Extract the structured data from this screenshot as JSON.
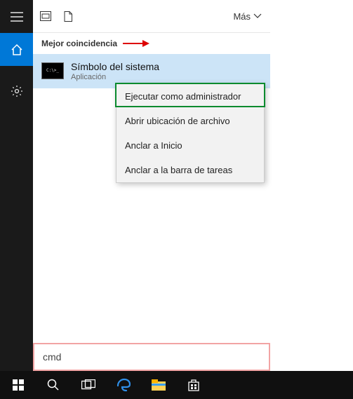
{
  "header": {
    "more_label": "Más"
  },
  "section": {
    "best_match_label": "Mejor coincidencia"
  },
  "result": {
    "title": "Símbolo del sistema",
    "subtitle": "Aplicación",
    "icon_glyph": "C:\\>_"
  },
  "context_menu": {
    "items": [
      "Ejecutar como administrador",
      "Abrir ubicación de archivo",
      "Anclar a Inicio",
      "Anclar a la barra de tareas"
    ]
  },
  "search": {
    "value": "cmd"
  },
  "colors": {
    "accent": "#0078d7",
    "result_highlight": "#cce4f7",
    "annotation_red": "#d00000",
    "annotation_green": "#0a8a2e",
    "annotation_pink": "#f2a4a4"
  }
}
